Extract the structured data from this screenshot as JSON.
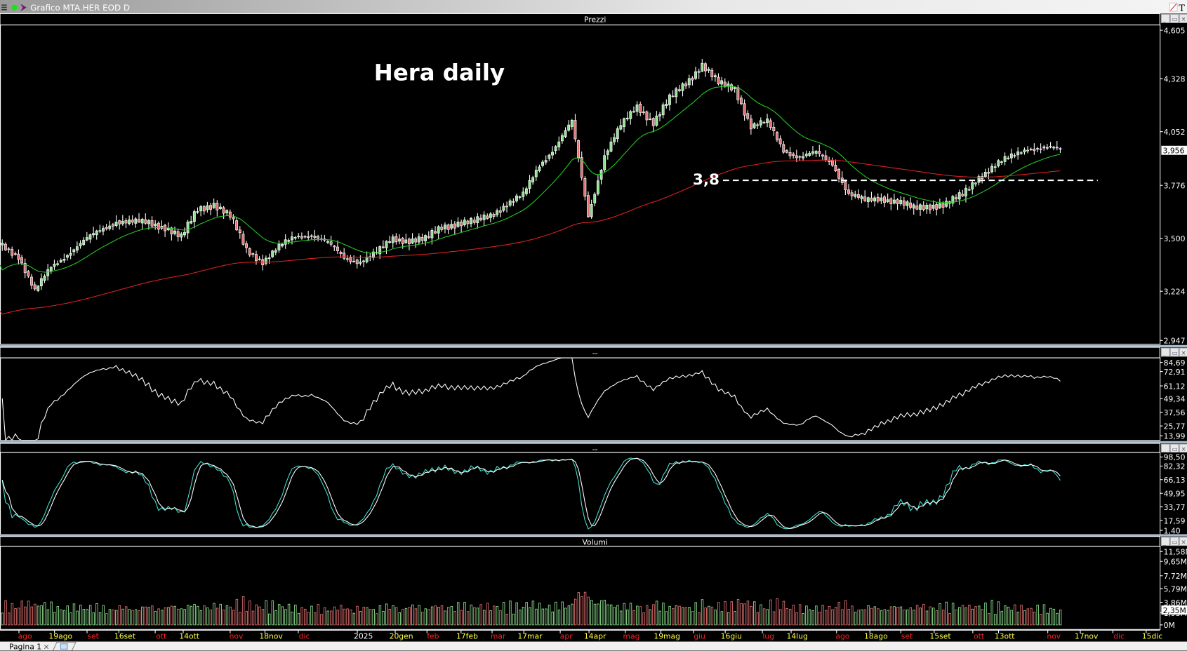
{
  "window": {
    "title": "Grafico MTA.HER EOD D",
    "status_color": "#22dd22"
  },
  "panels": {
    "price": {
      "title": "Prezzi",
      "axis_ticks": [
        "4,605",
        "4,328",
        "4,052",
        "3,776",
        "3,500",
        "3,224",
        "2,947"
      ],
      "last_value": "3,956"
    },
    "rsi": {
      "title": "--",
      "axis_ticks": [
        "84,69",
        "72,91",
        "61,12",
        "49,34",
        "37,56",
        "25,77",
        "13,99"
      ]
    },
    "stoch": {
      "title": "--",
      "axis_ticks": [
        "98,50",
        "82,32",
        "66,13",
        "49,95",
        "33,77",
        "17,59",
        "1,40"
      ]
    },
    "volume": {
      "title": "Volumi",
      "axis_ticks": [
        "11,58M",
        "9,65M",
        "7,72M",
        "5,79M",
        "3,86M",
        "1,93M",
        "0M"
      ],
      "last_value": "2,35M"
    }
  },
  "annotations": {
    "title": "Hera daily",
    "level_label": "3,8",
    "level_value": 3.8
  },
  "tabs": [
    {
      "label": "Pagina 1"
    }
  ],
  "date_labels": [
    {
      "t": "ago",
      "c": "month"
    },
    {
      "t": "19ago",
      "c": "day"
    },
    {
      "t": "set",
      "c": "month"
    },
    {
      "t": "16set",
      "c": "day"
    },
    {
      "t": "ott",
      "c": "month"
    },
    {
      "t": "14ott",
      "c": "day"
    },
    {
      "t": "nov",
      "c": "month"
    },
    {
      "t": "18nov",
      "c": "day"
    },
    {
      "t": "dic",
      "c": "month"
    },
    {
      "t": "2025",
      "c": "year"
    },
    {
      "t": "20gen",
      "c": "day"
    },
    {
      "t": "feb",
      "c": "month"
    },
    {
      "t": "17feb",
      "c": "day"
    },
    {
      "t": "mar",
      "c": "month"
    },
    {
      "t": "17mar",
      "c": "day"
    },
    {
      "t": "apr",
      "c": "month"
    },
    {
      "t": "14apr",
      "c": "day"
    },
    {
      "t": "mag",
      "c": "month"
    },
    {
      "t": "19mag",
      "c": "day"
    },
    {
      "t": "giu",
      "c": "month"
    },
    {
      "t": "16giu",
      "c": "day"
    },
    {
      "t": "lug",
      "c": "month"
    },
    {
      "t": "14lug",
      "c": "day"
    },
    {
      "t": "ago",
      "c": "month"
    },
    {
      "t": "18ago",
      "c": "day"
    },
    {
      "t": "set",
      "c": "month"
    },
    {
      "t": "15set",
      "c": "day"
    },
    {
      "t": "ott",
      "c": "month"
    },
    {
      "t": "13ott",
      "c": "day"
    },
    {
      "t": "nov",
      "c": "month"
    },
    {
      "t": "17nov",
      "c": "day"
    },
    {
      "t": "dic",
      "c": "month"
    },
    {
      "t": "15dic",
      "c": "day"
    }
  ],
  "colors": {
    "month": "#ff2020",
    "day": "#ffff40",
    "year": "#ffffff",
    "up": "#8fe08f",
    "down": "#e07070",
    "ma_short": "#22cc22",
    "ma_long": "#dd2222",
    "rsi": "#ffffff",
    "stoch_k": "#40e0d0",
    "stoch_d": "#ffffff"
  },
  "chart_data": {
    "type": "candlestick",
    "price_range": [
      2.947,
      4.605
    ],
    "weekly_closes": [
      3.46,
      3.41,
      3.22,
      3.35,
      3.42,
      3.48,
      3.54,
      3.59,
      3.58,
      3.58,
      3.56,
      3.5,
      3.65,
      3.68,
      3.61,
      3.44,
      3.38,
      3.45,
      3.51,
      3.52,
      3.47,
      3.4,
      3.38,
      3.42,
      3.5,
      3.49,
      3.49,
      3.56,
      3.58,
      3.58,
      3.62,
      3.68,
      3.72,
      3.88,
      3.98,
      4.1,
      3.62,
      3.93,
      4.08,
      4.19,
      4.1,
      4.22,
      4.31,
      4.4,
      4.3,
      4.28,
      4.08,
      4.1,
      3.96,
      3.92,
      3.94,
      3.89,
      3.73,
      3.69,
      3.71,
      3.69,
      3.65,
      3.67,
      3.68,
      3.72,
      3.82,
      3.88,
      3.92,
      3.97,
      3.97,
      3.956
    ],
    "volume_range": [
      0,
      11.58
    ],
    "volume_unit": "M",
    "last_volume": 2.35
  }
}
